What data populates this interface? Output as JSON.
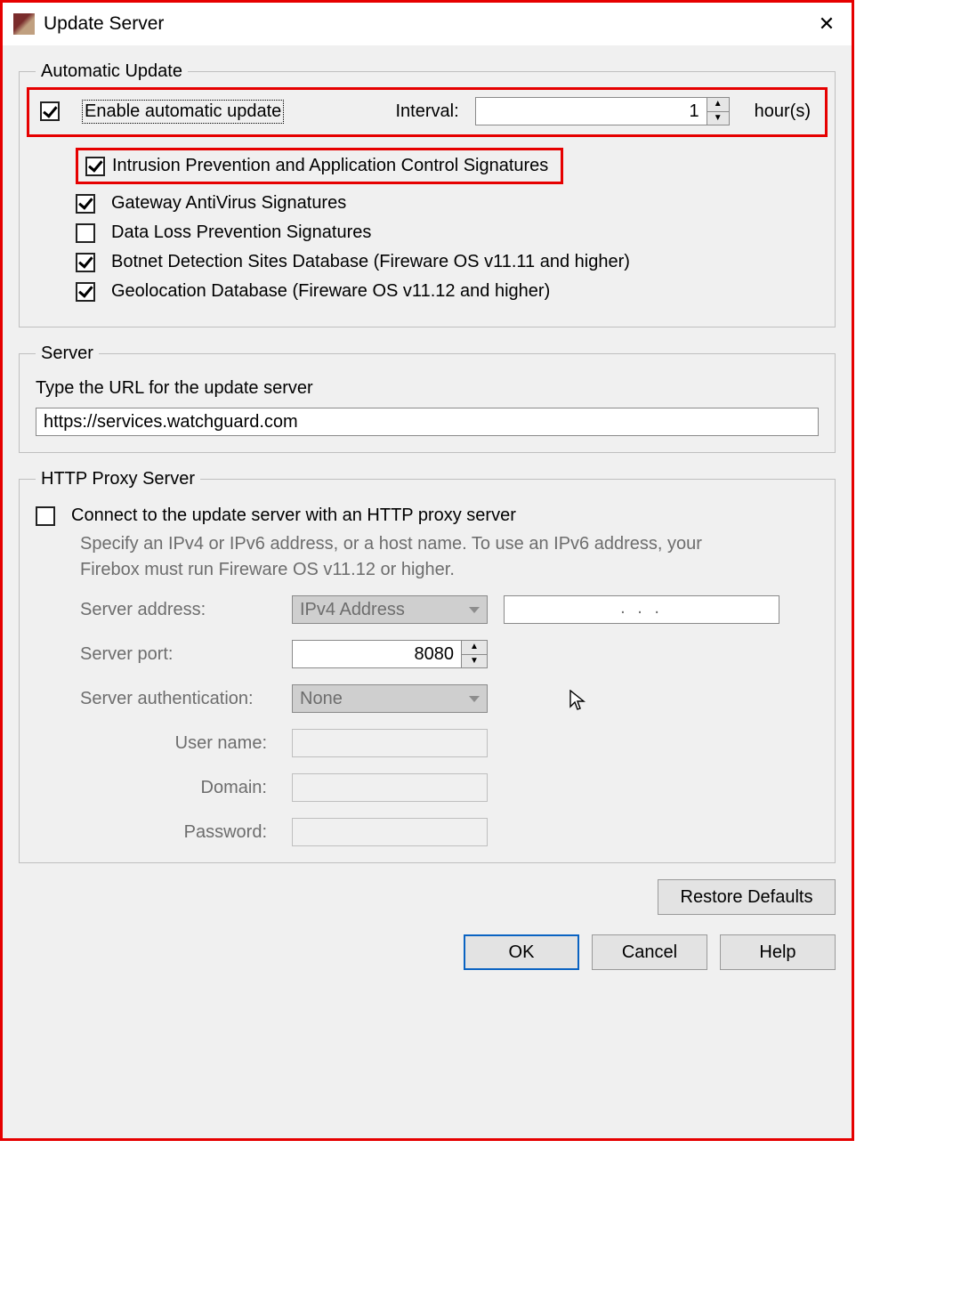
{
  "window": {
    "title": "Update Server"
  },
  "auto": {
    "legend": "Automatic Update",
    "enable": "Enable automatic update",
    "interval_label": "Interval:",
    "interval_value": "1",
    "unit": "hour(s)",
    "signatures": {
      "ips": "Intrusion Prevention and Application Control Signatures",
      "gav": "Gateway AntiVirus Signatures",
      "dlp": "Data Loss Prevention Signatures",
      "botnet": "Botnet Detection Sites Database (Fireware OS v11.11 and higher)",
      "geo": "Geolocation Database (Fireware OS v11.12 and higher)"
    }
  },
  "server": {
    "legend": "Server",
    "desc": "Type the URL for the update server",
    "url": "https://services.watchguard.com"
  },
  "proxy": {
    "legend": "HTTP Proxy Server",
    "enable": "Connect to the update server with an HTTP proxy server",
    "help": "Specify an IPv4 or IPv6 address, or a host name. To use an IPv6 address, your Firebox must run Fireware OS v11.12 or higher.",
    "addr_label": "Server address:",
    "addr_type": "IPv4 Address",
    "addr_value": ".       .       .",
    "port_label": "Server port:",
    "port_value": "8080",
    "auth_label": "Server authentication:",
    "auth_value": "None",
    "user_label": "User name:",
    "domain_label": "Domain:",
    "pass_label": "Password:"
  },
  "buttons": {
    "restore": "Restore Defaults",
    "ok": "OK",
    "cancel": "Cancel",
    "help": "Help"
  }
}
